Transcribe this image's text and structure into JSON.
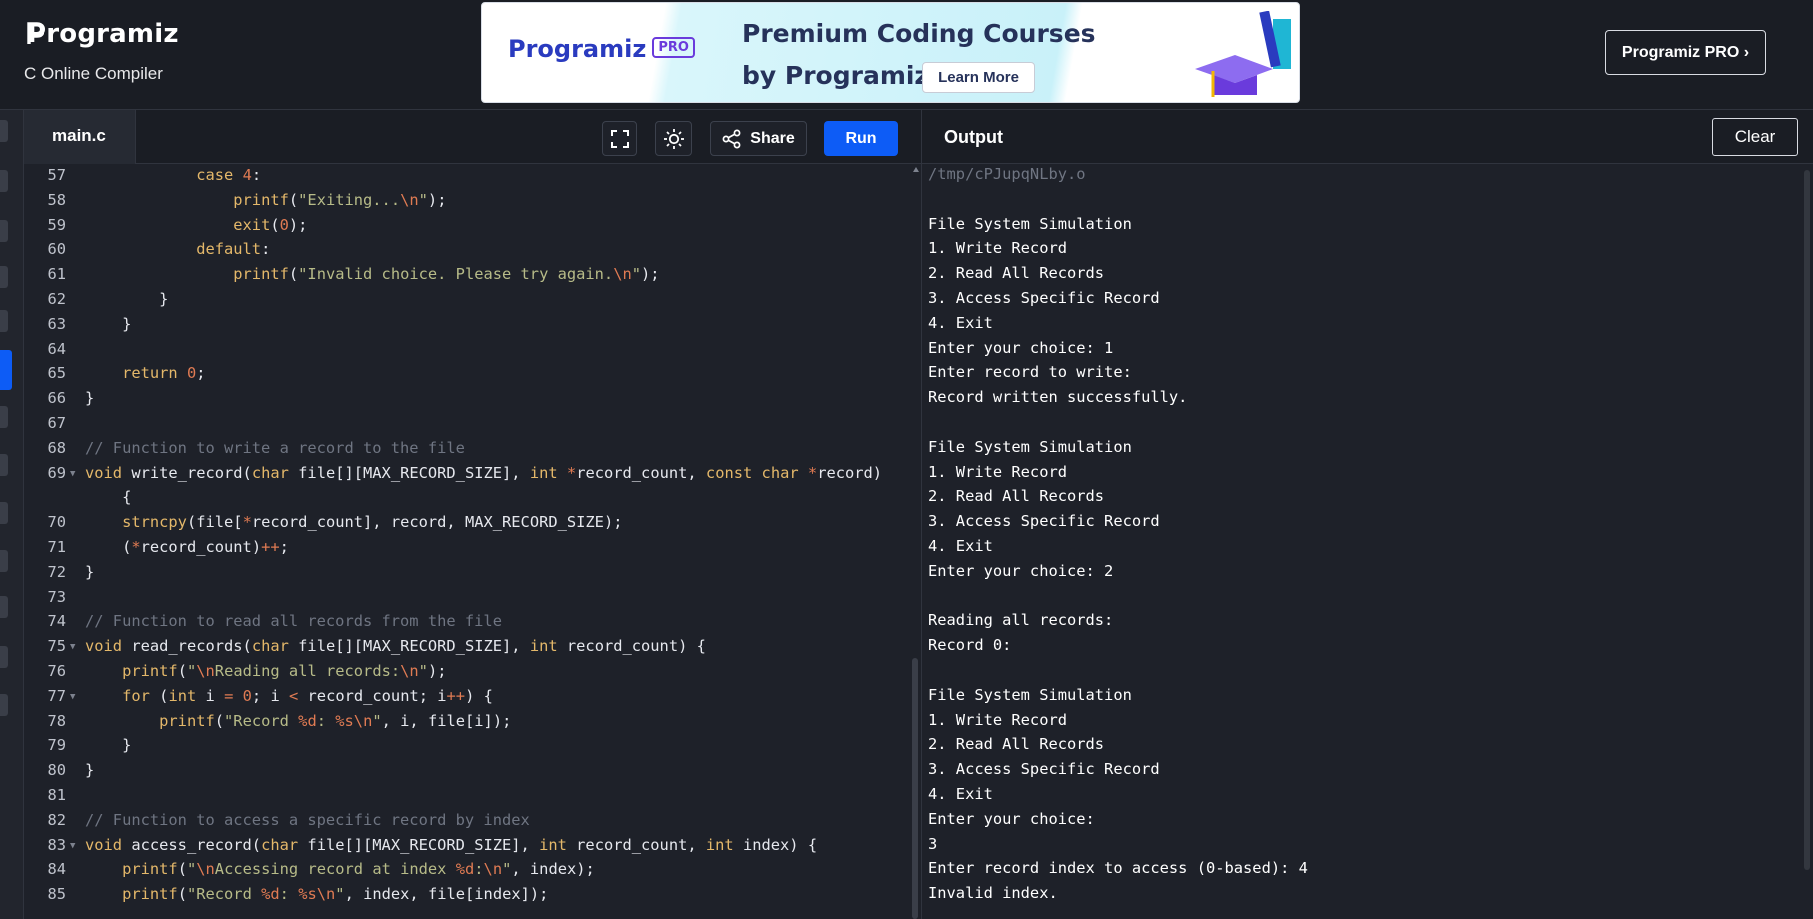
{
  "app": {
    "logo_text": "Programiz",
    "subtitle": "C Online Compiler",
    "pro_button": "Programiz PRO ›"
  },
  "banner": {
    "logo_text": "Programiz",
    "pro_badge": "PRO",
    "title_line1": "Premium Coding Courses",
    "title_line2": "by Programiz",
    "cta": "Learn More"
  },
  "editor": {
    "tab": "main.c",
    "share_label": "Share",
    "run_label": "Run",
    "icons": [
      "fullscreen-icon",
      "theme-sun-icon",
      "share-icon"
    ],
    "lines": [
      {
        "n": "57",
        "fold": false,
        "html": "            <span class='kw'>case</span> <span class='num'>4</span>:"
      },
      {
        "n": "58",
        "fold": false,
        "html": "                <span class='fn'>printf</span>(<span class='str'>\"Exiting...</span><span class='esc'>\\n</span><span class='str'>\"</span>);"
      },
      {
        "n": "59",
        "fold": false,
        "html": "                <span class='fn'>exit</span>(<span class='num'>0</span>);"
      },
      {
        "n": "60",
        "fold": false,
        "html": "            <span class='kw'>default</span>:"
      },
      {
        "n": "61",
        "fold": false,
        "html": "                <span class='fn'>printf</span>(<span class='str'>\"Invalid choice. Please try again.</span><span class='esc'>\\n</span><span class='str'>\"</span>);"
      },
      {
        "n": "62",
        "fold": false,
        "html": "        }"
      },
      {
        "n": "63",
        "fold": false,
        "html": "    }"
      },
      {
        "n": "64",
        "fold": false,
        "html": ""
      },
      {
        "n": "65",
        "fold": false,
        "html": "    <span class='kw'>return</span> <span class='num'>0</span>;"
      },
      {
        "n": "66",
        "fold": false,
        "html": "}"
      },
      {
        "n": "67",
        "fold": false,
        "html": ""
      },
      {
        "n": "68",
        "fold": false,
        "html": "<span class='cm'>// Function to write a record to the file</span>"
      },
      {
        "n": "69",
        "fold": true,
        "html": "<span class='kw'>void</span> write_record(<span class='kw'>char</span> file[][MAX_RECORD_SIZE], <span class='kw'>int</span> <span class='num'>*</span>record_count, <span class='kw'>const</span> <span class='kw'>char</span> <span class='num'>*</span>record)"
      },
      {
        "n": "",
        "fold": false,
        "html": "    {"
      },
      {
        "n": "70",
        "fold": false,
        "html": "    <span class='fn'>strncpy</span>(file[<span class='num'>*</span>record_count], record, MAX_RECORD_SIZE);"
      },
      {
        "n": "71",
        "fold": false,
        "html": "    (<span class='num'>*</span>record_count)<span class='num'>++</span>;"
      },
      {
        "n": "72",
        "fold": false,
        "html": "}"
      },
      {
        "n": "73",
        "fold": false,
        "html": ""
      },
      {
        "n": "74",
        "fold": false,
        "html": "<span class='cm'>// Function to read all records from the file</span>"
      },
      {
        "n": "75",
        "fold": true,
        "html": "<span class='kw'>void</span> read_records(<span class='kw'>char</span> file[][MAX_RECORD_SIZE], <span class='kw'>int</span> record_count) {"
      },
      {
        "n": "76",
        "fold": false,
        "html": "    <span class='fn'>printf</span>(<span class='str'>\"</span><span class='esc'>\\n</span><span class='str'>Reading all records:</span><span class='esc'>\\n</span><span class='str'>\"</span>);"
      },
      {
        "n": "77",
        "fold": true,
        "html": "    <span class='kw'>for</span> (<span class='kw'>int</span> i <span class='num'>=</span> <span class='num'>0</span>; i <span class='num'>&lt;</span> record_count; i<span class='num'>++</span>) {"
      },
      {
        "n": "78",
        "fold": false,
        "html": "        <span class='fn'>printf</span>(<span class='str'>\"Record </span><span class='esc'>%d</span><span class='str'>: </span><span class='esc'>%s\\n</span><span class='str'>\"</span>, i, file[i]);"
      },
      {
        "n": "79",
        "fold": false,
        "html": "    }"
      },
      {
        "n": "80",
        "fold": false,
        "html": "}"
      },
      {
        "n": "81",
        "fold": false,
        "html": ""
      },
      {
        "n": "82",
        "fold": false,
        "html": "<span class='cm'>// Function to access a specific record by index</span>"
      },
      {
        "n": "83",
        "fold": true,
        "html": "<span class='kw'>void</span> access_record(<span class='kw'>char</span> file[][MAX_RECORD_SIZE], <span class='kw'>int</span> record_count, <span class='kw'>int</span> index) {"
      },
      {
        "n": "84",
        "fold": false,
        "html": "    <span class='fn'>printf</span>(<span class='str'>\"</span><span class='esc'>\\n</span><span class='str'>Accessing record at index </span><span class='esc'>%d</span><span class='str'>:</span><span class='esc'>\\n</span><span class='str'>\"</span>, index);"
      },
      {
        "n": "85",
        "fold": false,
        "html": "    <span class='fn'>printf</span>(<span class='str'>\"Record </span><span class='esc'>%d</span><span class='str'>: </span><span class='esc'>%s\\n</span><span class='str'>\"</span>, index, file[index]);"
      }
    ]
  },
  "output": {
    "title": "Output",
    "clear_label": "Clear",
    "lines": [
      {
        "text": "/tmp/cPJupqNLby.o",
        "dim": true
      },
      {
        "text": "",
        "dim": false
      },
      {
        "text": "File System Simulation",
        "dim": false
      },
      {
        "text": "1. Write Record",
        "dim": false
      },
      {
        "text": "2. Read All Records",
        "dim": false
      },
      {
        "text": "3. Access Specific Record",
        "dim": false
      },
      {
        "text": "4. Exit",
        "dim": false
      },
      {
        "text": "Enter your choice: 1",
        "dim": false
      },
      {
        "text": "Enter record to write:",
        "dim": false
      },
      {
        "text": "Record written successfully.",
        "dim": false
      },
      {
        "text": "",
        "dim": false
      },
      {
        "text": "File System Simulation",
        "dim": false
      },
      {
        "text": "1. Write Record",
        "dim": false
      },
      {
        "text": "2. Read All Records",
        "dim": false
      },
      {
        "text": "3. Access Specific Record",
        "dim": false
      },
      {
        "text": "4. Exit",
        "dim": false
      },
      {
        "text": "Enter your choice: 2",
        "dim": false
      },
      {
        "text": "",
        "dim": false
      },
      {
        "text": "Reading all records:",
        "dim": false
      },
      {
        "text": "Record 0:",
        "dim": false
      },
      {
        "text": "",
        "dim": false
      },
      {
        "text": "File System Simulation",
        "dim": false
      },
      {
        "text": "1. Write Record",
        "dim": false
      },
      {
        "text": "2. Read All Records",
        "dim": false
      },
      {
        "text": "3. Access Specific Record",
        "dim": false
      },
      {
        "text": "4. Exit",
        "dim": false
      },
      {
        "text": "Enter your choice:",
        "dim": false
      },
      {
        "text": "3",
        "dim": false
      },
      {
        "text": "Enter record index to access (0-based): 4",
        "dim": false
      },
      {
        "text": "Invalid index.",
        "dim": false
      }
    ]
  },
  "colors": {
    "accent": "#0d5cf6",
    "background": "#1e2129",
    "keyword": "#e4b86a",
    "string": "#b7bb88",
    "number": "#e07b53",
    "comment": "#6f7582"
  }
}
